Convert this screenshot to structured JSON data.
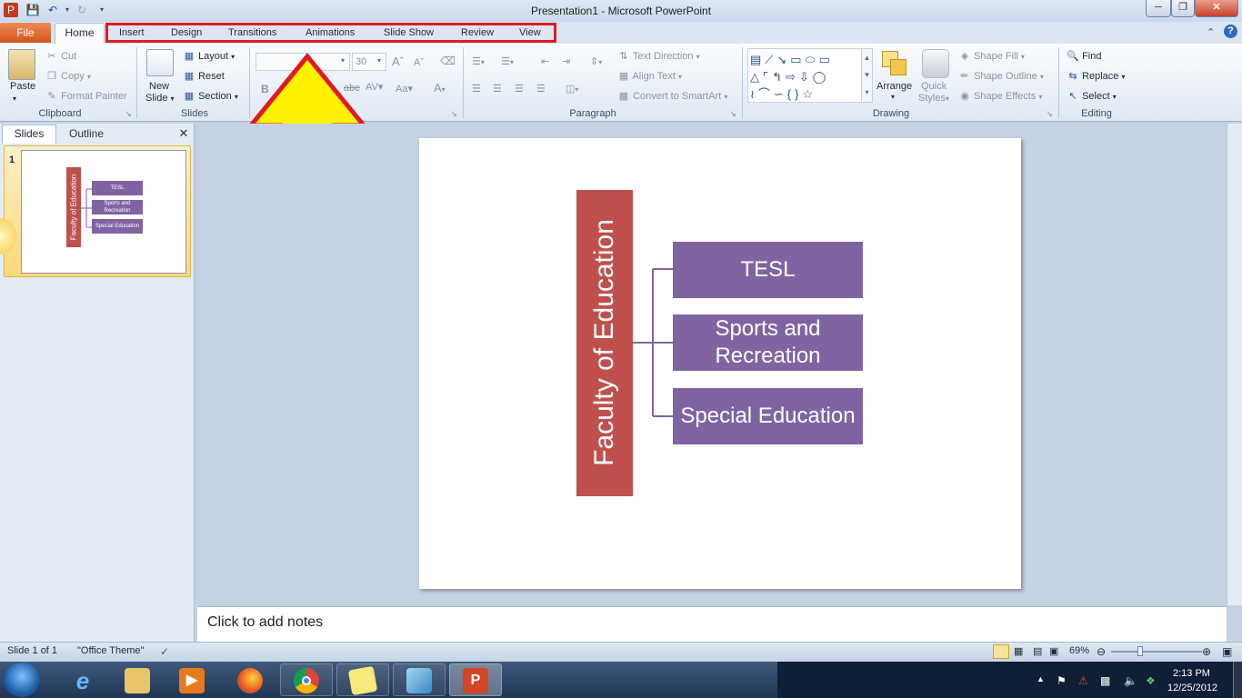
{
  "window": {
    "title": "Presentation1  -  Microsoft PowerPoint"
  },
  "tabs": {
    "file": "File",
    "home": "Home",
    "others": [
      "Insert",
      "Design",
      "Transitions",
      "Animations",
      "Slide Show",
      "Review",
      "View"
    ]
  },
  "ribbon": {
    "clipboard": {
      "paste": "Paste",
      "cut": "Cut",
      "copy": "Copy",
      "format_painter": "Format Painter",
      "label": "Clipboard"
    },
    "slides": {
      "new_slide_1": "New",
      "new_slide_2": "Slide",
      "layout": "Layout",
      "reset": "Reset",
      "section": "Section",
      "label": "Slides"
    },
    "font": {
      "size": "30",
      "bold": "B",
      "label_fragment": "t"
    },
    "paragraph": {
      "text_direction": "Text Direction",
      "align_text": "Align Text",
      "convert_smartart": "Convert to SmartArt",
      "label": "Paragraph"
    },
    "drawing": {
      "arrange": "Arrange",
      "quick_1": "Quick",
      "quick_2": "Styles",
      "shape_fill": "Shape Fill",
      "shape_outline": "Shape Outline",
      "shape_effects": "Shape Effects",
      "label": "Drawing"
    },
    "editing": {
      "find": "Find",
      "replace": "Replace",
      "select": "Select",
      "label": "Editing"
    }
  },
  "slide_pane": {
    "tab_slides": "Slides",
    "tab_outline": "Outline",
    "slide_number": "1"
  },
  "slide": {
    "root": "Faculty of Education",
    "children": [
      "TESL",
      "Sports and Recreation",
      "Special Education"
    ],
    "root_color": "#c0504d",
    "child_color": "#8064a2"
  },
  "thumbnail": {
    "root": "Faculty of Education",
    "children": [
      "TESL",
      "Sports and Recreation",
      "Special Education"
    ]
  },
  "notes": {
    "placeholder": "Click to add notes"
  },
  "status": {
    "slide": "Slide 1 of 1",
    "theme": "\"Office Theme\"",
    "zoom": "69%"
  },
  "taskbar": {
    "time": "2:13 PM",
    "date": "12/25/2012"
  },
  "annotation": {
    "arrow_color": "#fff200",
    "highlight_color": "#e01a22"
  }
}
